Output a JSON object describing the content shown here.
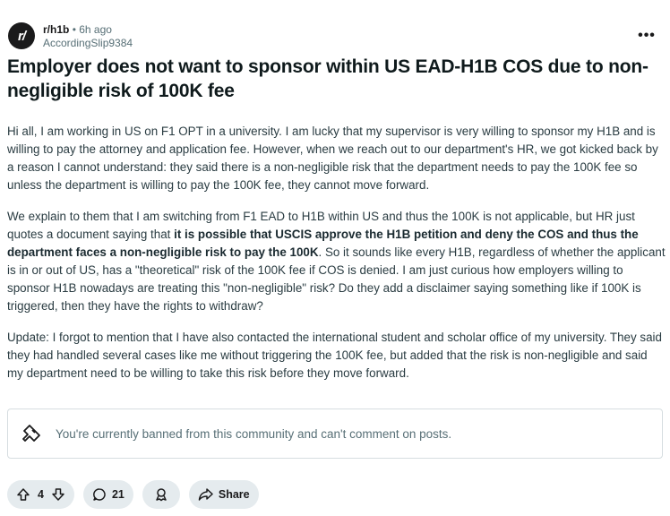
{
  "post": {
    "subreddit": "r/h1b",
    "separator": "•",
    "time": "6h ago",
    "author": "AccordingSlip9384",
    "avatar_text": "r/",
    "more_label": "•••",
    "title": "Employer does not want to sponsor within US EAD-H1B COS due to non-negligible risk of 100K fee",
    "body": {
      "p1": "Hi all, I am working in US on F1 OPT in a university. I am lucky that my supervisor is very willing to sponsor my H1B and is willing to pay the attorney and application fee. However, when we reach out to our department's HR, we got kicked back by a reason I cannot understand: they said there is a non-negligible risk that the department needs to pay the 100K fee so unless the department is willing to pay the 100K fee, they cannot move forward.",
      "p2_start": "We explain to them that I am switching from F1 EAD to H1B within US and thus the 100K is not applicable, but HR just quotes a document saying that ",
      "p2_bold": "it is possible that USCIS approve the H1B petition and deny the COS and thus the department faces a non-negligible risk to pay the 100K",
      "p2_end": ". So it sounds like every H1B, regardless of whether the applicant is in or out of US, has a \"theoretical\" risk of the 100K fee if COS is denied. I am just curious how employers willing to sponsor H1B nowadays are treating this \"non-negligible\" risk? Do they add a disclaimer saying something like if 100K is triggered, then they have the rights to withdraw?",
      "p3": "Update: I forgot to mention that I have also contacted the international student and scholar office of my university. They said they had handled several cases like me without triggering the 100K fee, but added that the risk is non-negligible and said my department need to be willing to take this risk before they move forward."
    }
  },
  "banned_notice": {
    "icon": "no-comment-icon",
    "text": "You're currently banned from this community and can't comment on posts."
  },
  "actions": {
    "votes": "4",
    "comments": "21",
    "share_label": "Share"
  }
}
